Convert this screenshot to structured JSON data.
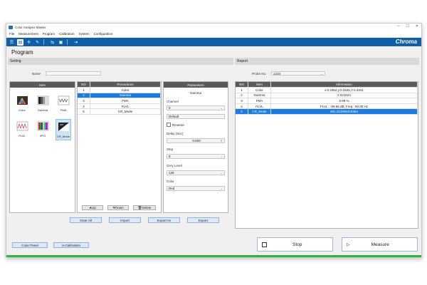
{
  "window": {
    "title": "Color Analysis Master",
    "brand": "Chroma"
  },
  "menu": [
    "File",
    "Measurement",
    "Program",
    "Calibration",
    "System",
    "Configuration"
  ],
  "toolbar": {
    "icons": [
      "program-icon",
      "edit-icon",
      "plus-icon",
      "pen-icon",
      "share-icon",
      "save-icon",
      "exit-icon"
    ]
  },
  "page_title": "Program",
  "setting": {
    "title": "Setting",
    "name_label": "Name",
    "name_value": "",
    "item_header": "Item",
    "items": [
      "Color",
      "Gamma",
      "FMA",
      "FLVL",
      "VPG",
      "CR_Mode"
    ],
    "procedures": {
      "headers": [
        "NO",
        "Procedures"
      ],
      "rows": [
        [
          "1",
          "Color"
        ],
        [
          "2",
          "Gamma"
        ],
        [
          "3",
          "FMA"
        ],
        [
          "4",
          "FLVL"
        ],
        [
          "5",
          "CR_Mode"
        ]
      ],
      "selected_index": 1,
      "buttons": [
        "Up",
        "Down",
        "Delete"
      ]
    },
    "parameters": {
      "header": "Parameters",
      "name": "Gamma",
      "channel_label": "Channel",
      "channel_value": "0",
      "default_value": "Default",
      "reverse_label": "Reverse",
      "delay_label": "Delay (Sec)",
      "delay_value": "0.500",
      "step_label": "Step",
      "step_value": "8",
      "grey_label": "Grey Level",
      "grey_value": "128",
      "color_label": "Color",
      "color_value": "Red"
    },
    "actions": [
      "Clear All",
      "Import",
      "Export As",
      "Export"
    ]
  },
  "report": {
    "title": "Report",
    "probe_label": "Probe No.",
    "probe_value": "1234",
    "headers": [
      "NO",
      "Item",
      "Information"
    ],
    "rows": [
      [
        "1",
        "Color",
        "x:0.2352,y:0.2535,Y:5.3341"
      ],
      [
        "2",
        "Gamma",
        "2.021024"
      ],
      [
        "3",
        "FMA",
        "0.09 %"
      ],
      [
        "4",
        "FLVL",
        "FLVL : -59.65 dB, Freq : 60.00 Hz"
      ],
      [
        "5",
        "CR_Mode",
        "591.421505415364"
      ]
    ],
    "selected_index": 4
  },
  "bottom": {
    "color_panel": "Color Panel",
    "s_calibration": "S-Calibration",
    "stop": "Stop",
    "measure": "Measure"
  },
  "colors": {
    "accent": "#0f5fa8",
    "selection": "#1a7be0",
    "status_bar": "#2fb43a"
  }
}
